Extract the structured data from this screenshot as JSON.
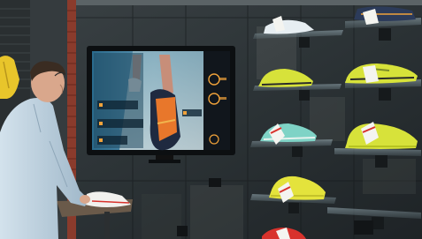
{
  "screen": {
    "brand_text": "",
    "headline_text": "",
    "metric_text": ""
  },
  "colors": {
    "screen_accent": "#f0a23a",
    "screen_panel": "#2d5f7a",
    "shoe_yellow": "#d7e23a",
    "shoe_mint": "#7fd3c6",
    "shoe_red": "#d8322c",
    "shirt": "#bcd1e0",
    "brick": "#8a3b2c"
  },
  "icons": [
    "display-screen",
    "shoe-on-shelf",
    "price-tag",
    "shopper"
  ]
}
